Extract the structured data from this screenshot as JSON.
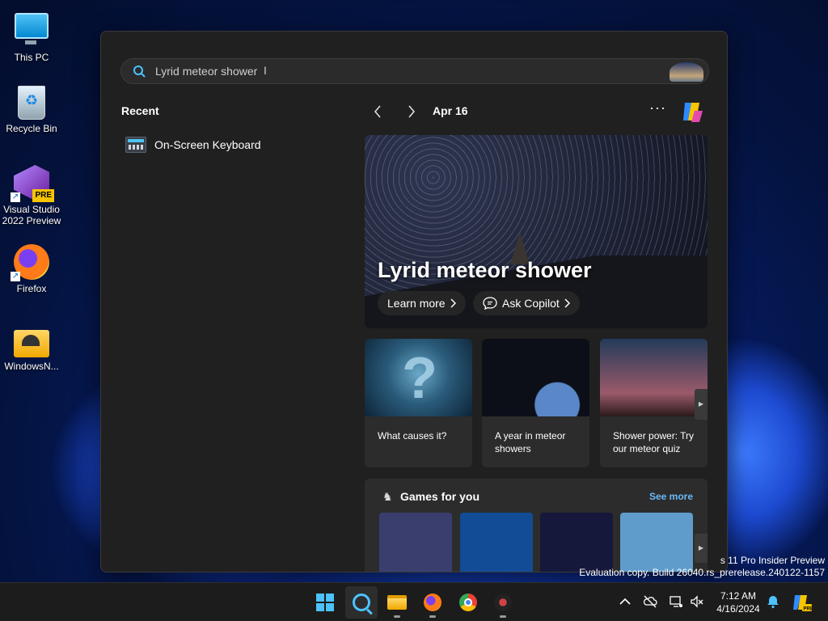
{
  "desktop": {
    "icons": [
      {
        "label": "This PC",
        "icon": "computer-icon"
      },
      {
        "label": "Recycle Bin",
        "icon": "recycle-bin-icon"
      },
      {
        "label": "Visual Studio 2022 Preview",
        "icon": "visual-studio-icon",
        "badge": "PRE"
      },
      {
        "label": "Firefox",
        "icon": "firefox-icon"
      },
      {
        "label": "WindowsN...",
        "icon": "folder-icon"
      }
    ]
  },
  "search": {
    "query": "Lyrid meteor shower"
  },
  "recent": {
    "title": "Recent",
    "items": [
      {
        "label": "On-Screen Keyboard",
        "icon": "keyboard-icon"
      }
    ]
  },
  "highlights": {
    "date": "Apr 16",
    "more_glyph": "···",
    "hero": {
      "headline": "Lyrid meteor shower",
      "learn_more": "Learn more",
      "ask_copilot": "Ask Copilot"
    },
    "cards": [
      {
        "text": "What causes it?"
      },
      {
        "text": "A year in meteor showers"
      },
      {
        "text": "Shower power: Try our meteor quiz"
      }
    ],
    "games": {
      "title": "Games for you",
      "see_more": "See more"
    }
  },
  "watermark": {
    "line1": "s 11 Pro Insider Preview",
    "line2": "Evaluation copy. Build 26040.rs_prerelease.240122-1157"
  },
  "taskbar": {
    "time": "7:12 AM",
    "date": "4/16/2024",
    "accent_color": "#4cc2ff"
  }
}
